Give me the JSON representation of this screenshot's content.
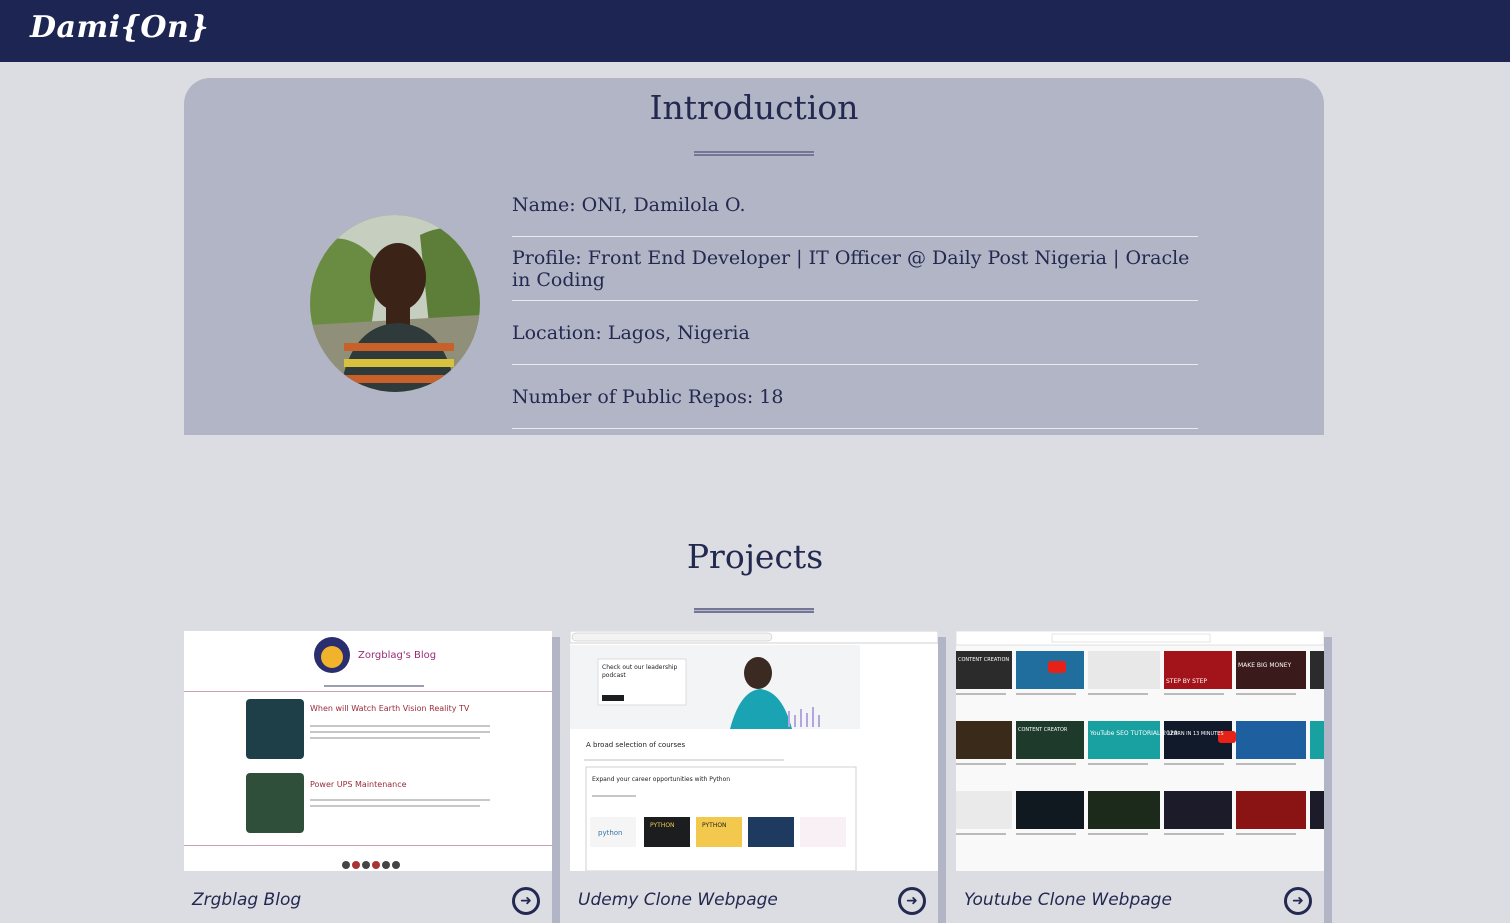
{
  "brand": {
    "logo": "Dami{On}"
  },
  "intro": {
    "title": "Introduction",
    "rows": [
      "Name: ONI, Damilola O.",
      "Profile: Front End Developer | IT Officer @ Daily Post Nigeria | Oracle in Coding",
      "Location: Lagos, Nigeria",
      "Number of Public Repos: 18"
    ]
  },
  "projects": {
    "title": "Projects",
    "items": [
      {
        "name": "Zrgblag Blog",
        "arrow": "➜"
      },
      {
        "name": "Udemy Clone Webpage",
        "arrow": "➜"
      },
      {
        "name": "Youtube Clone Webpage",
        "arrow": "➜"
      }
    ]
  },
  "thumbs": {
    "blog": {
      "title": "Zorgblag's Blog",
      "post1": "When will Watch Earth Vision Reality TV",
      "post2": "Power UPS Maintenance"
    },
    "udemy": {
      "promo1": "Check out our leadership",
      "promo2": "podcast",
      "courses": "A broad selection of courses",
      "section": "Expand your career opportunities with Python",
      "tile1": "python",
      "tile2": "PYTHON",
      "tile3": "PYTHON"
    },
    "youtube": {
      "labels": [
        "CONTENT CREATION",
        "MAKE BIG MONEY",
        "STEP BY STEP",
        "YouTube SEO TUTORIAL 2020",
        "LEARN IN 13 MINUTES",
        "CONTENT CREATOR"
      ]
    }
  },
  "colors": {
    "navbar": "#1d2552",
    "page": "#dcdde3",
    "card": "#b2b5c6",
    "text": "#23294f"
  }
}
